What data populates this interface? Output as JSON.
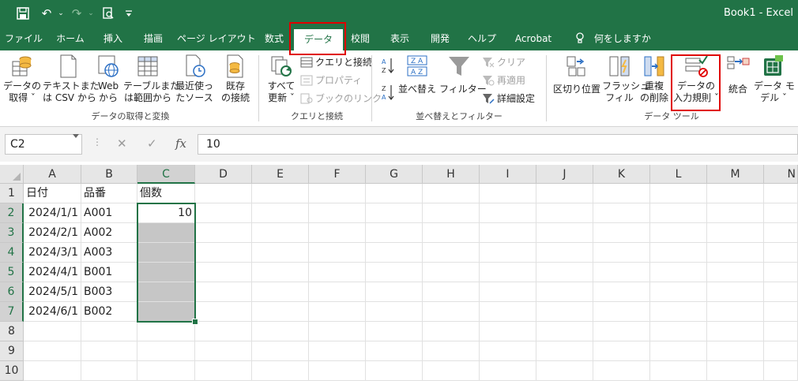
{
  "window": {
    "title": "Book1  -  Excel"
  },
  "tabs": [
    "ファイル",
    "ホーム",
    "挿入",
    "描画",
    "ページ レイアウト",
    "数式",
    "データ",
    "校閲",
    "表示",
    "開発",
    "ヘルプ",
    "Acrobat"
  ],
  "active_tab": "データ",
  "tell_me": "何をしますか",
  "ribbon": {
    "get_data": "データの\n取得 ˇ",
    "from_csv": "テキストまた\nは CSV から",
    "from_web": "Web\nから",
    "from_table": "テーブルまた\nは範囲から",
    "recent_sources": "最近使っ\nたソース",
    "existing_conn": "既存\nの接続",
    "group_get": "データの取得と変換",
    "refresh_all": "すべて\n更新 ˇ",
    "queries_conn": "クエリと接続",
    "properties": "プロパティ",
    "edit_links": "ブックのリンク",
    "group_queries": "クエリと接続",
    "sort_az": "A→Z",
    "sort_za": "Z→A",
    "sort": "並べ替え",
    "filter": "フィルター",
    "clear": "クリア",
    "reapply": "再適用",
    "advanced": "詳細設定",
    "group_sort": "並べ替えとフィルター",
    "text_to_columns": "区切り位置",
    "flash_fill": "フラッシュ\nフィル",
    "remove_duplicates": "重複\nの削除",
    "data_validation": "データの\n入力規則 ˇ",
    "consolidate": "統合",
    "data_model": "データ モ\nデル ˇ",
    "group_tools": "データ ツール"
  },
  "formula_bar": {
    "name_box": "C2",
    "cancel": "✕",
    "enter": "✓",
    "fx": "fx",
    "formula": "10"
  },
  "sheet": {
    "columns": [
      "A",
      "B",
      "C",
      "D",
      "E",
      "F",
      "G",
      "H",
      "I",
      "J",
      "K",
      "L",
      "M",
      "N"
    ],
    "rows": [
      "1",
      "2",
      "3",
      "4",
      "5",
      "6",
      "7",
      "8",
      "9",
      "10"
    ],
    "cells": [
      [
        "日付",
        "品番",
        "個数"
      ],
      [
        "2024/1/1",
        "A001",
        "10"
      ],
      [
        "2024/2/1",
        "A002",
        ""
      ],
      [
        "2024/3/1",
        "A003",
        ""
      ],
      [
        "2024/4/1",
        "B001",
        ""
      ],
      [
        "2024/5/1",
        "B003",
        ""
      ],
      [
        "2024/6/1",
        "B002",
        ""
      ]
    ],
    "selected": "C2:C7"
  },
  "colors": {
    "excel_green": "#217346",
    "highlight_red": "#e00000",
    "selection_fill": "#c6c6c6"
  }
}
